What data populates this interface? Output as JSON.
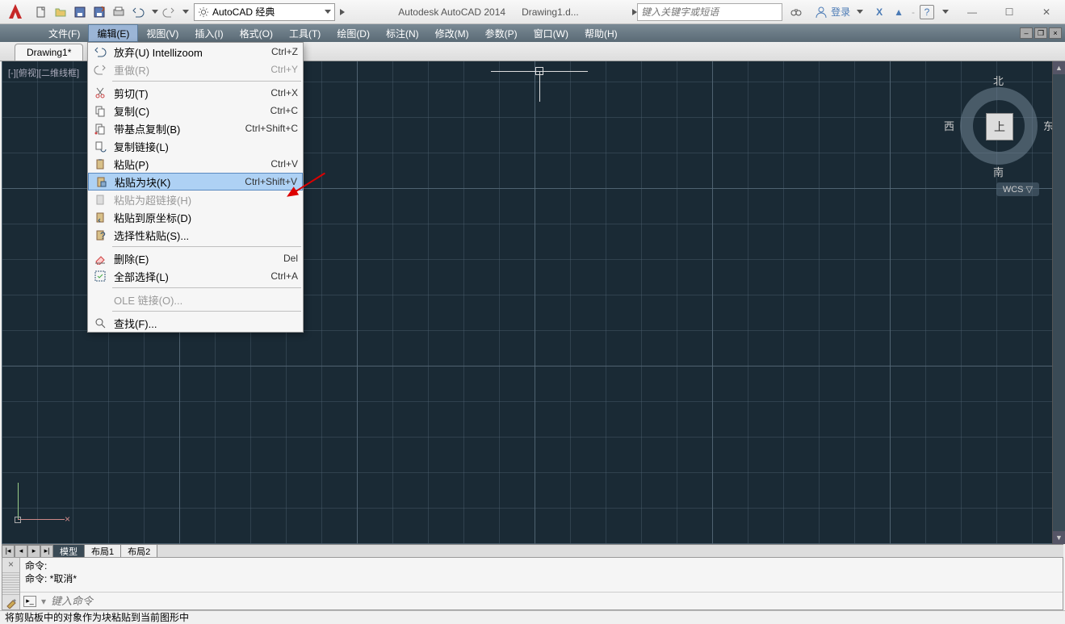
{
  "app": {
    "title": "Autodesk AutoCAD 2014",
    "doc": "Drawing1.d..."
  },
  "workspace": {
    "label": "AutoCAD 经典"
  },
  "search": {
    "placeholder": "键入关键字或短语"
  },
  "login": {
    "label": "登录"
  },
  "menubar": {
    "items": [
      {
        "label": "文件(F)"
      },
      {
        "label": "编辑(E)"
      },
      {
        "label": "视图(V)"
      },
      {
        "label": "插入(I)"
      },
      {
        "label": "格式(O)"
      },
      {
        "label": "工具(T)"
      },
      {
        "label": "绘图(D)"
      },
      {
        "label": "标注(N)"
      },
      {
        "label": "修改(M)"
      },
      {
        "label": "参数(P)"
      },
      {
        "label": "窗口(W)"
      },
      {
        "label": "帮助(H)"
      }
    ]
  },
  "doc_tab": "Drawing1*",
  "view_label": "[-][俯视][二维线框]",
  "viewcube": {
    "face": "上",
    "n": "北",
    "s": "南",
    "e": "东",
    "w": "西"
  },
  "wcs": "WCS ▽",
  "layout_tabs": {
    "model": "模型",
    "l1": "布局1",
    "l2": "布局2"
  },
  "cmd": {
    "line1": "命令:",
    "line2": "命令: *取消*",
    "placeholder": "键入命令"
  },
  "status": "将剪贴板中的对象作为块粘贴到当前图形中",
  "edit_menu": [
    {
      "label": "放弃(U) Intellizoom",
      "shortcut": "Ctrl+Z",
      "icon": "undo"
    },
    {
      "label": "重做(R)",
      "shortcut": "Ctrl+Y",
      "icon": "redo",
      "disabled": true
    },
    "sep",
    {
      "label": "剪切(T)",
      "shortcut": "Ctrl+X",
      "icon": "cut"
    },
    {
      "label": "复制(C)",
      "shortcut": "Ctrl+C",
      "icon": "copy"
    },
    {
      "label": "带基点复制(B)",
      "shortcut": "Ctrl+Shift+C",
      "icon": "copy-base"
    },
    {
      "label": "复制链接(L)",
      "shortcut": "",
      "icon": "copy-link"
    },
    {
      "label": "粘贴(P)",
      "shortcut": "Ctrl+V",
      "icon": "paste"
    },
    {
      "label": "粘贴为块(K)",
      "shortcut": "Ctrl+Shift+V",
      "icon": "paste-block",
      "highlighted": true
    },
    {
      "label": "粘贴为超链接(H)",
      "shortcut": "",
      "icon": "paste-link",
      "disabled": true
    },
    {
      "label": "粘贴到原坐标(D)",
      "shortcut": "",
      "icon": "paste-orig"
    },
    {
      "label": "选择性粘贴(S)...",
      "shortcut": "",
      "icon": "paste-special"
    },
    "sep",
    {
      "label": "删除(E)",
      "shortcut": "Del",
      "icon": "erase"
    },
    {
      "label": "全部选择(L)",
      "shortcut": "Ctrl+A",
      "icon": "select-all"
    },
    "sep",
    {
      "label": "OLE 链接(O)...",
      "shortcut": "",
      "icon": "",
      "disabled": true
    },
    "sep",
    {
      "label": "查找(F)...",
      "shortcut": "",
      "icon": "find"
    }
  ]
}
